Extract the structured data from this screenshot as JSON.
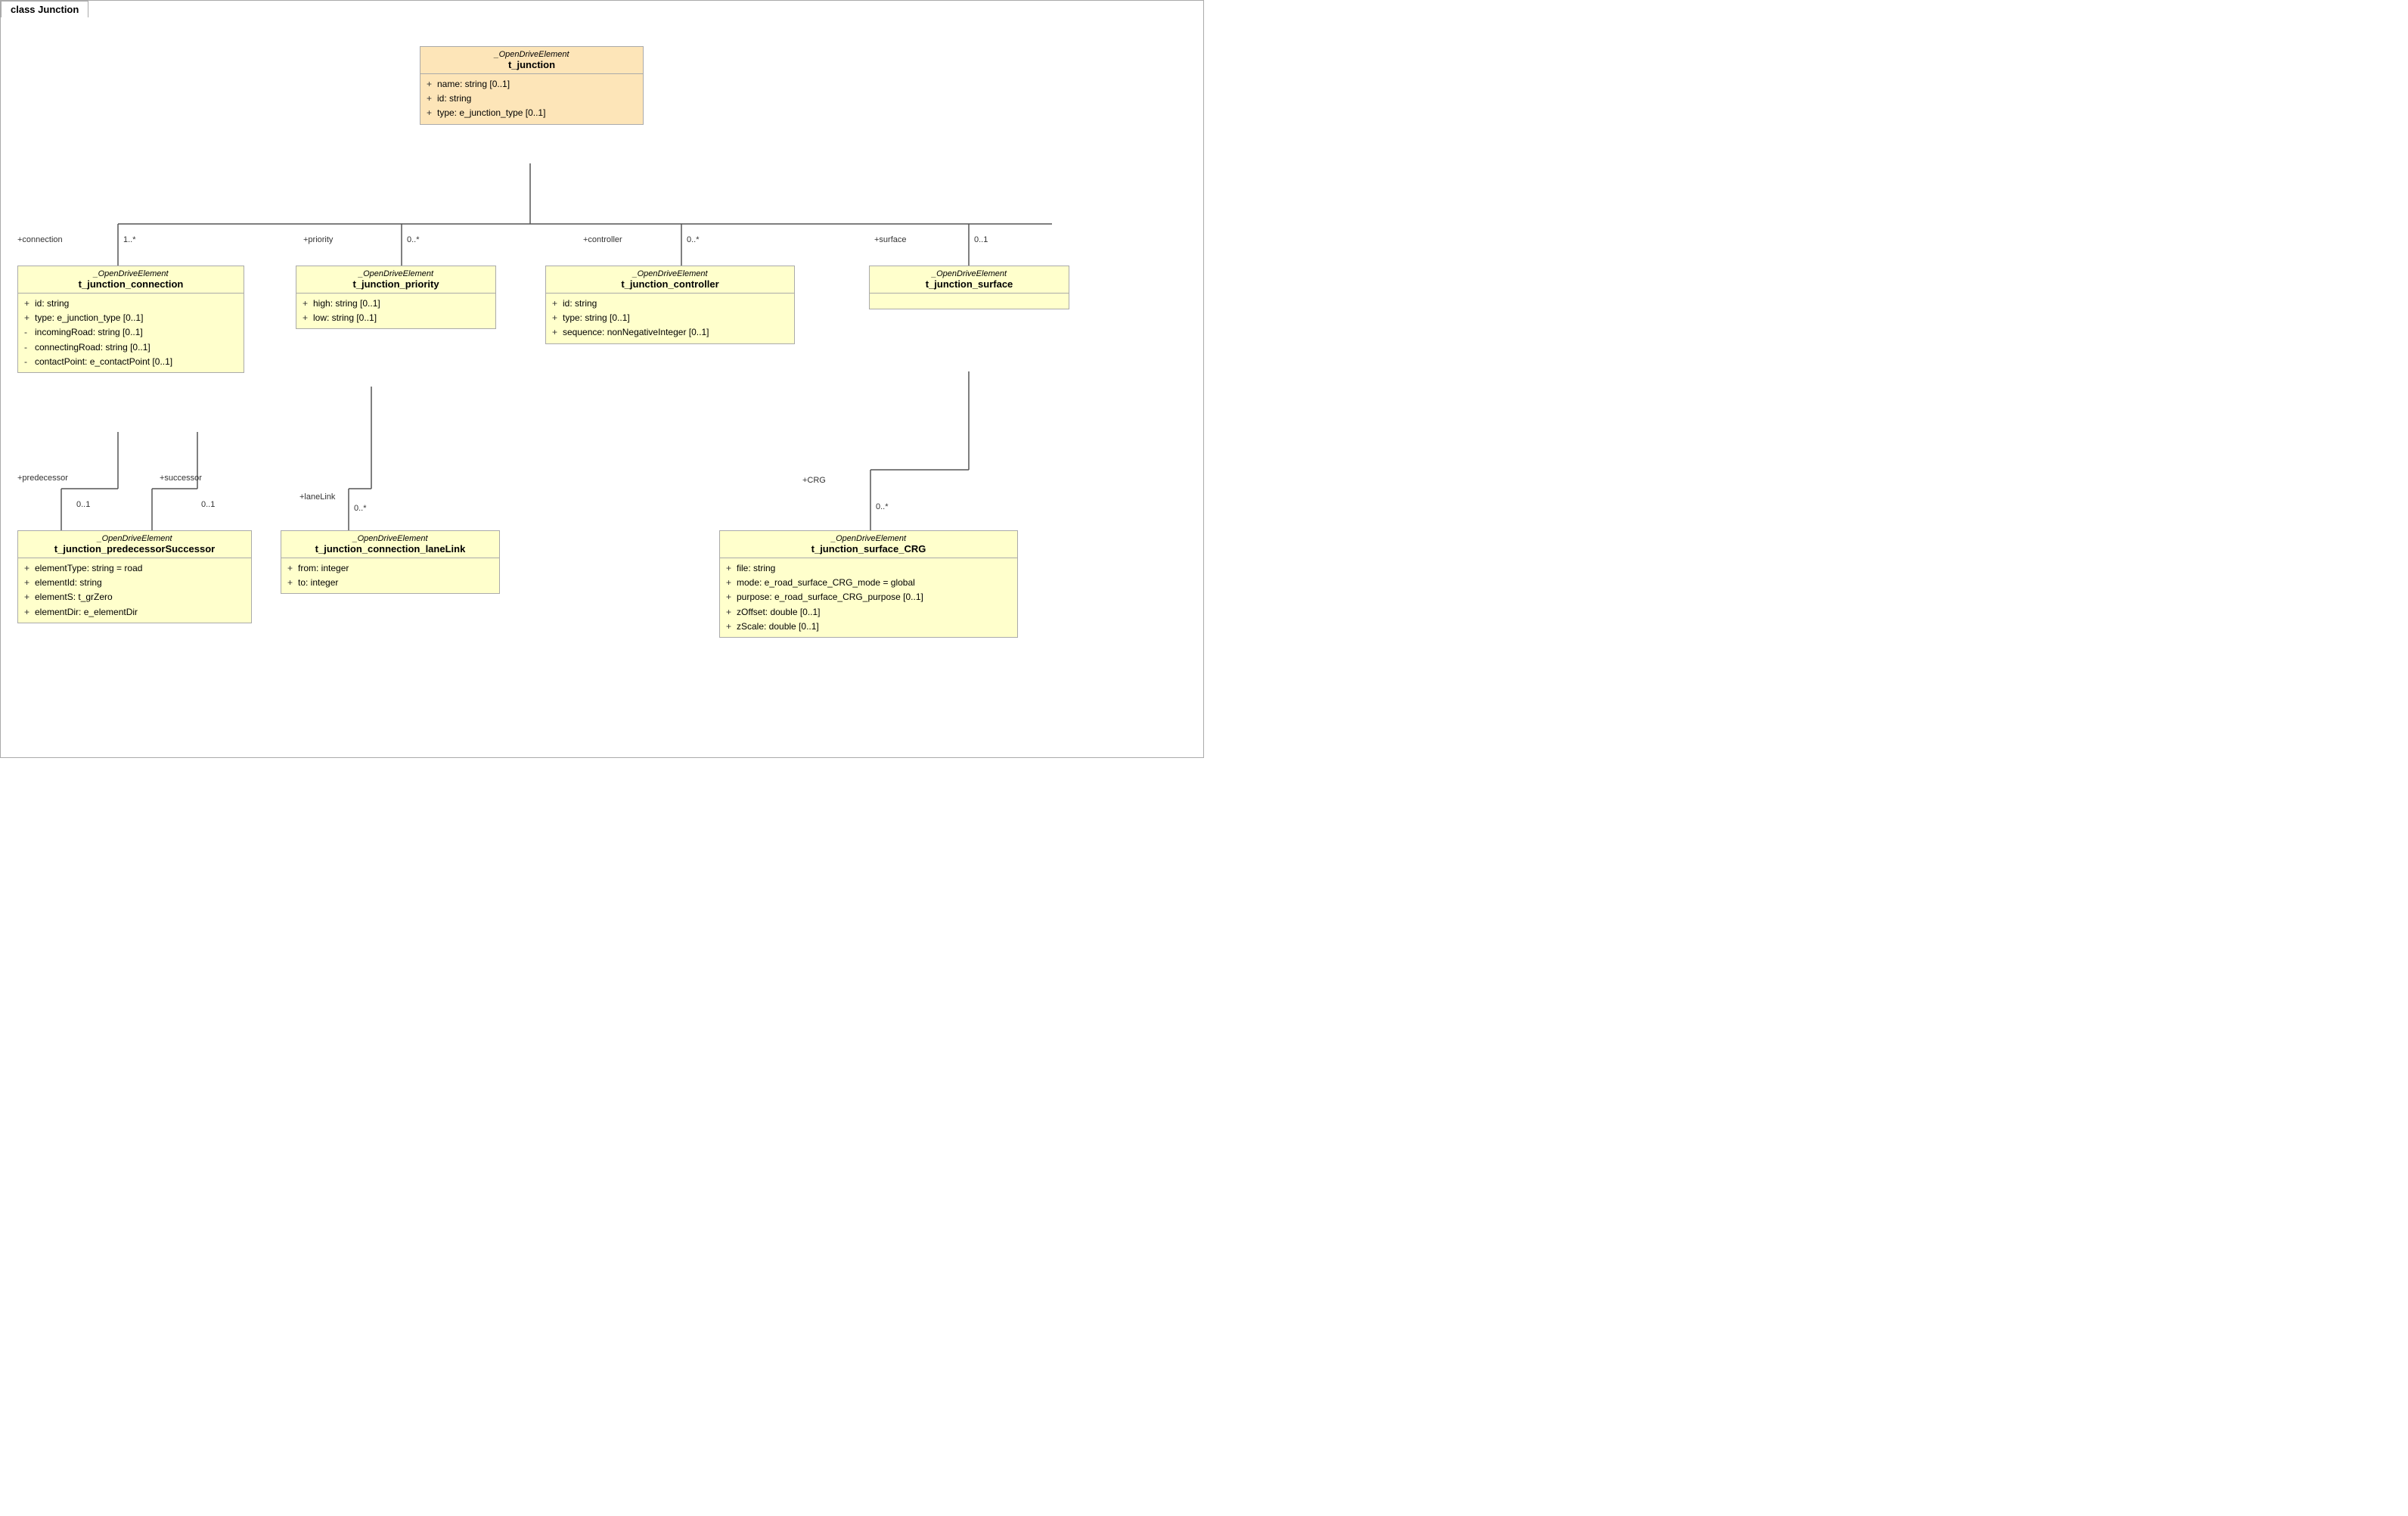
{
  "diagram": {
    "title": "class Junction",
    "colors": {
      "orange_bg": "#fde5b8",
      "yellow_bg": "#ffffcc",
      "border": "#aaa"
    },
    "boxes": {
      "t_junction": {
        "stereotype": "_OpenDriveElement",
        "name": "t_junction",
        "attrs": [
          {
            "vis": "+",
            "text": "name: string [0..1]"
          },
          {
            "vis": "+",
            "text": "id: string"
          },
          {
            "vis": "+",
            "text": "type: e_junction_type [0..1]"
          }
        ]
      },
      "t_junction_connection": {
        "stereotype": "_OpenDriveElement",
        "name": "t_junction_connection",
        "attrs": [
          {
            "vis": "+",
            "text": "id: string"
          },
          {
            "vis": "+",
            "text": "type: e_junction_type [0..1]"
          },
          {
            "vis": "-",
            "text": "incomingRoad: string [0..1]"
          },
          {
            "vis": "-",
            "text": "connectingRoad: string [0..1]"
          },
          {
            "vis": "-",
            "text": "contactPoint: e_contactPoint [0..1]"
          }
        ]
      },
      "t_junction_priority": {
        "stereotype": "_OpenDriveElement",
        "name": "t_junction_priority",
        "attrs": [
          {
            "vis": "+",
            "text": "high: string [0..1]"
          },
          {
            "vis": "+",
            "text": "low: string [0..1]"
          }
        ]
      },
      "t_junction_controller": {
        "stereotype": "_OpenDriveElement",
        "name": "t_junction_controller",
        "attrs": [
          {
            "vis": "+",
            "text": "id: string"
          },
          {
            "vis": "+",
            "text": "type: string [0..1]"
          },
          {
            "vis": "+",
            "text": "sequence: nonNegativeInteger [0..1]"
          }
        ]
      },
      "t_junction_surface": {
        "stereotype": "_OpenDriveElement",
        "name": "t_junction_surface",
        "attrs": []
      },
      "t_junction_predecessorSuccessor": {
        "stereotype": "_OpenDriveElement",
        "name": "t_junction_predecessorSuccessor",
        "attrs": [
          {
            "vis": "+",
            "text": "elementType: string = road"
          },
          {
            "vis": "+",
            "text": "elementId: string"
          },
          {
            "vis": "+",
            "text": "elementS: t_grZero"
          },
          {
            "vis": "+",
            "text": "elementDir: e_elementDir"
          }
        ]
      },
      "t_junction_connection_laneLink": {
        "stereotype": "_OpenDriveElement",
        "name": "t_junction_connection_laneLink",
        "attrs": [
          {
            "vis": "+",
            "text": "from: integer"
          },
          {
            "vis": "+",
            "text": "to: integer"
          }
        ]
      },
      "t_junction_surface_CRG": {
        "stereotype": "_OpenDriveElement",
        "name": "t_junction_surface_CRG",
        "attrs": [
          {
            "vis": "+",
            "text": "file: string"
          },
          {
            "vis": "+",
            "text": "mode: e_road_surface_CRG_mode = global"
          },
          {
            "vis": "+",
            "text": "purpose: e_road_surface_CRG_purpose [0..1]"
          },
          {
            "vis": "+",
            "text": "zOffset: double [0..1]"
          },
          {
            "vis": "+",
            "text": "zScale: double [0..1]"
          }
        ]
      }
    },
    "labels": {
      "connection_role": "+connection",
      "connection_mult": "1..*",
      "priority_role": "+priority",
      "priority_mult": "0..*",
      "controller_role": "+controller",
      "controller_mult": "0..*",
      "surface_role": "+surface",
      "surface_mult": "0..1",
      "predecessor_role": "+predecessor",
      "predecessor_mult": "0..1",
      "successor_role": "+successor",
      "successor_mult": "0..1",
      "laneLink_role": "+laneLink",
      "laneLink_mult": "0..*",
      "crg_role": "+CRG",
      "crg_mult": "0..*"
    }
  }
}
